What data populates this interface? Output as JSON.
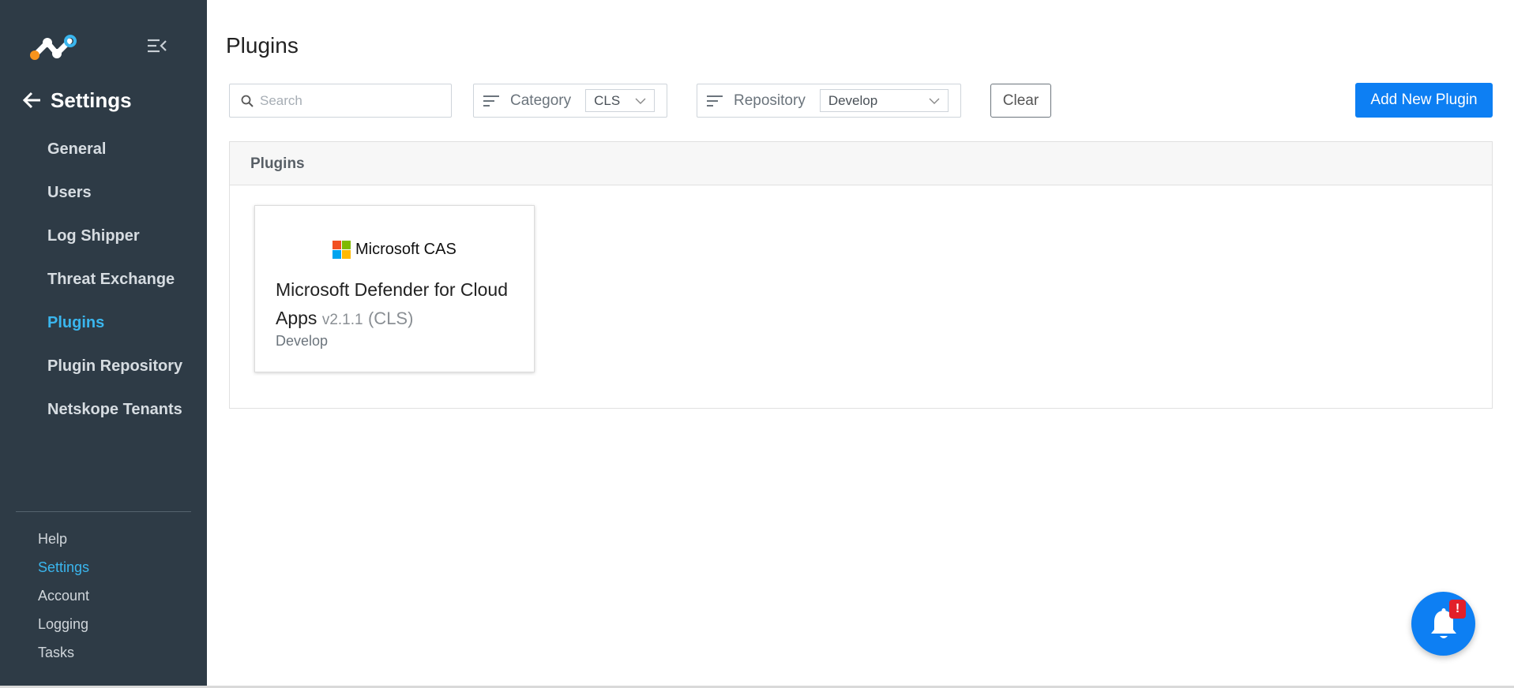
{
  "sidebar": {
    "back_label": "Settings",
    "items": [
      {
        "label": "General",
        "active": false
      },
      {
        "label": "Users",
        "active": false
      },
      {
        "label": "Log Shipper",
        "active": false
      },
      {
        "label": "Threat Exchange",
        "active": false
      },
      {
        "label": "Plugins",
        "active": true
      },
      {
        "label": "Plugin Repository",
        "active": false
      },
      {
        "label": "Netskope Tenants",
        "active": false
      }
    ],
    "bottom_items": [
      {
        "label": "Help",
        "active": false
      },
      {
        "label": "Settings",
        "active": true
      },
      {
        "label": "Account",
        "active": false
      },
      {
        "label": "Logging",
        "active": false
      },
      {
        "label": "Tasks",
        "active": false
      }
    ]
  },
  "main": {
    "title": "Plugins",
    "search": {
      "placeholder": "Search",
      "value": ""
    },
    "category_filter": {
      "label": "Category",
      "selected": "CLS"
    },
    "repository_filter": {
      "label": "Repository",
      "selected": "Develop"
    },
    "clear_label": "Clear",
    "add_label": "Add New Plugin",
    "panel": {
      "title": "Plugins",
      "cards": [
        {
          "logo_text": "Microsoft CAS",
          "name": "Microsoft Defender for Cloud Apps",
          "version": "v2.1.1",
          "category": "(CLS)",
          "repository": "Develop"
        }
      ]
    },
    "notification": {
      "badge": "!"
    }
  },
  "colors": {
    "sidebar_bg": "#2e3b46",
    "accent": "#3ab6ee",
    "primary": "#0d7ff3",
    "badge": "#e2202a",
    "ms_red": "#f25022",
    "ms_green": "#7fba00",
    "ms_blue": "#00a4ef",
    "ms_yellow": "#ffb900"
  },
  "icons": {
    "logo": "netskope-logo-icon",
    "collapse": "menu-collapse-icon",
    "back": "arrow-left-icon",
    "search": "search-icon",
    "filter": "sort-icon",
    "dropdown": "chevron-down-icon",
    "notification": "bell-icon"
  }
}
